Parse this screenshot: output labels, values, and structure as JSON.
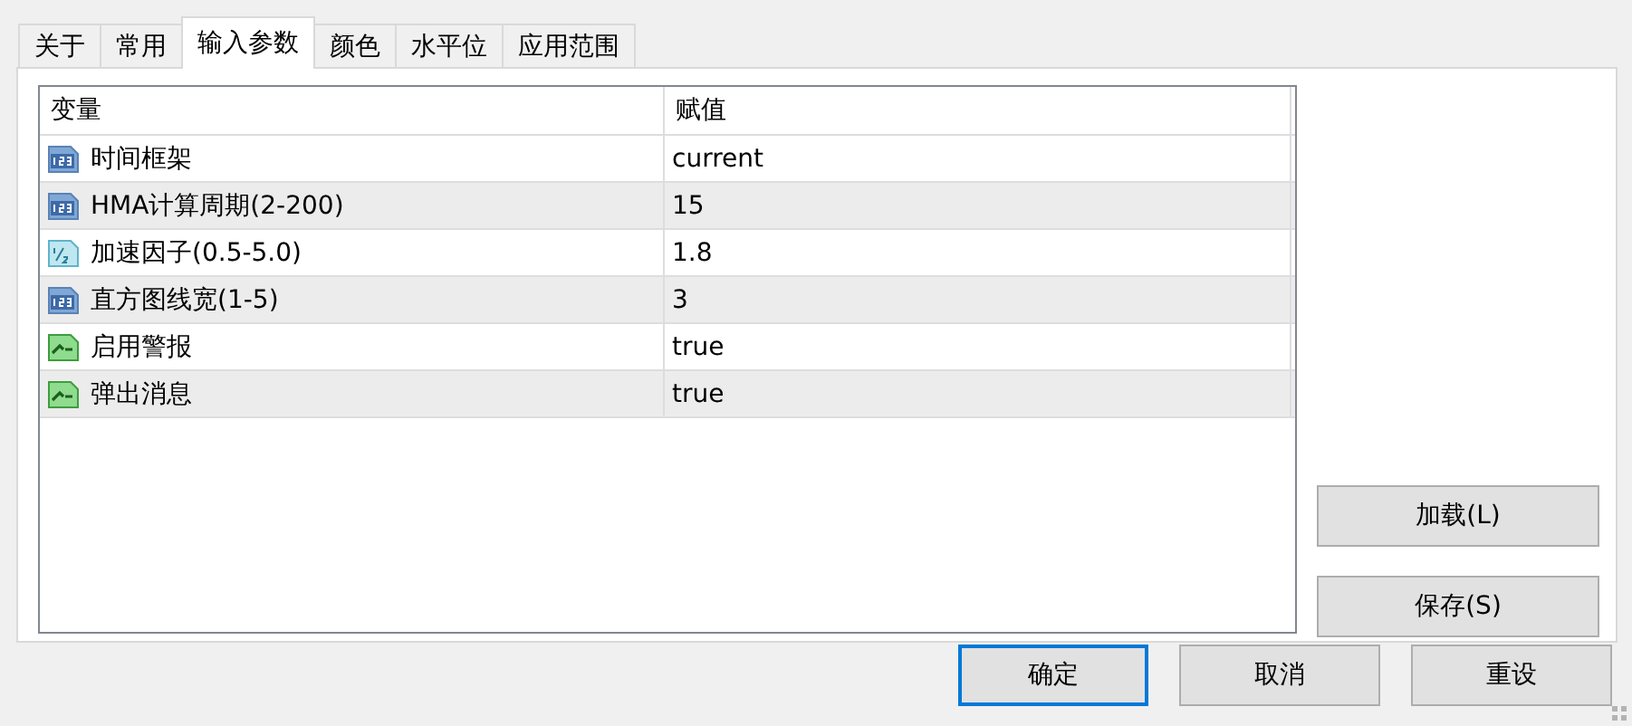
{
  "tabs": [
    {
      "label": "关于",
      "selected": false
    },
    {
      "label": "常用",
      "selected": false
    },
    {
      "label": "输入参数",
      "selected": true
    },
    {
      "label": "颜色",
      "selected": false
    },
    {
      "label": "水平位",
      "selected": false
    },
    {
      "label": "应用范围",
      "selected": false
    }
  ],
  "table": {
    "columns": [
      "变量",
      "赋值"
    ],
    "rows": [
      {
        "kind": "integer",
        "name": "时间框架",
        "value": "current"
      },
      {
        "kind": "integer",
        "name": "HMA计算周期(2-200)",
        "value": "15"
      },
      {
        "kind": "double",
        "name": "加速因子(0.5-5.0)",
        "value": "1.8"
      },
      {
        "kind": "integer",
        "name": "直方图线宽(1-5)",
        "value": "3"
      },
      {
        "kind": "bool",
        "name": "启用警报",
        "value": "true"
      },
      {
        "kind": "bool",
        "name": "弹出消息",
        "value": "true"
      }
    ]
  },
  "side_buttons": [
    "加载(L)",
    "保存(S)"
  ],
  "buttons": [
    {
      "label": "确定",
      "default": true
    },
    {
      "label": "取消",
      "default": false
    },
    {
      "label": "重设",
      "default": false
    }
  ]
}
